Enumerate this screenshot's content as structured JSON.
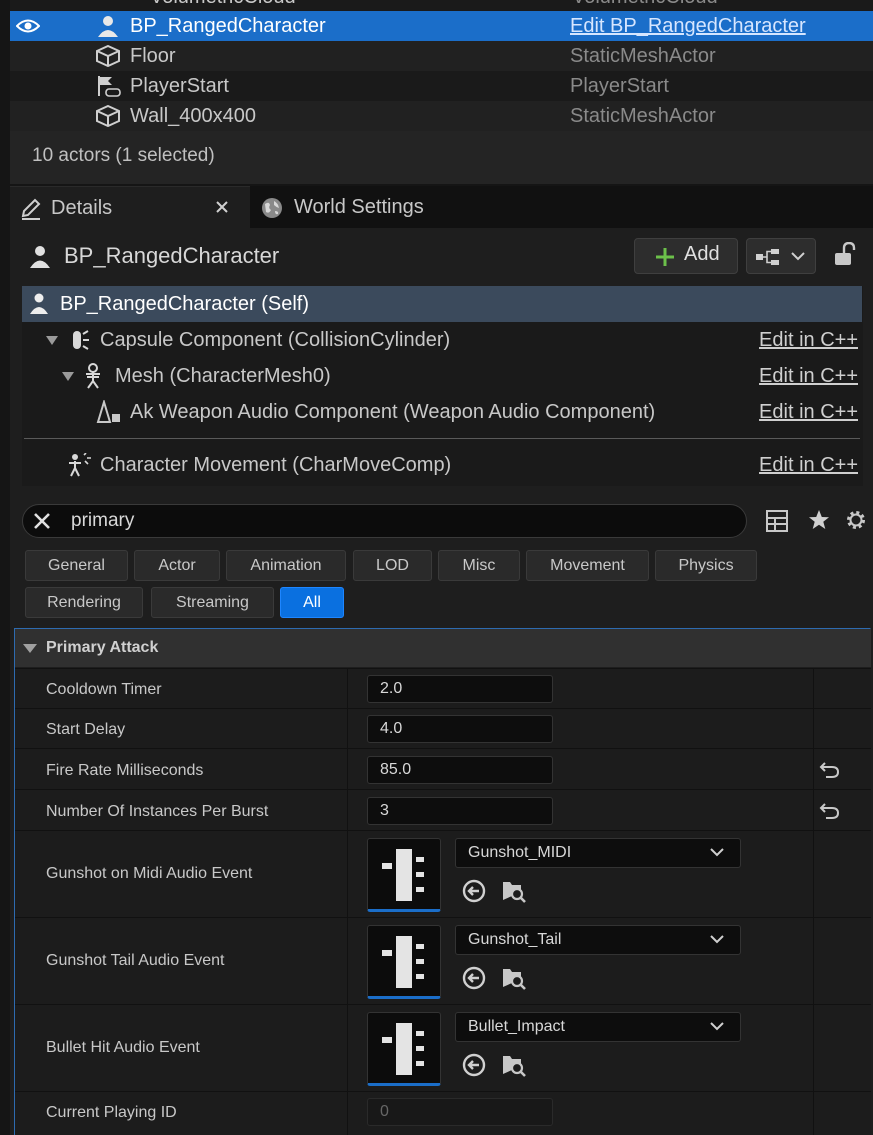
{
  "outliner": {
    "rows": [
      {
        "name": "VolumetricCloud",
        "type": "VolumetricCloud"
      },
      {
        "name": "BP_RangedCharacter",
        "type": "Edit BP_RangedCharacter"
      },
      {
        "name": "Floor",
        "type": "StaticMeshActor"
      },
      {
        "name": "PlayerStart",
        "type": "PlayerStart"
      },
      {
        "name": "Wall_400x400",
        "type": "StaticMeshActor"
      }
    ],
    "actor_count": "10 actors (1 selected)"
  },
  "tabs": {
    "details": "Details",
    "world_settings": "World Settings"
  },
  "details": {
    "actor_name": "BP_RangedCharacter",
    "add_label": "Add",
    "components": [
      {
        "label": "BP_RangedCharacter (Self)",
        "edit": ""
      },
      {
        "label": "Capsule Component (CollisionCylinder)",
        "edit": "Edit in C++"
      },
      {
        "label": "Mesh (CharacterMesh0)",
        "edit": "Edit in C++"
      },
      {
        "label": "Ak Weapon Audio Component (Weapon Audio Component)",
        "edit": "Edit in C++"
      },
      {
        "label": "Character Movement (CharMoveComp)",
        "edit": "Edit in C++"
      }
    ],
    "search_value": "primary",
    "filters": [
      "General",
      "Actor",
      "Animation",
      "LOD",
      "Misc",
      "Movement",
      "Physics",
      "Rendering",
      "Streaming",
      "All"
    ],
    "active_filter": "All",
    "category": "Primary Attack",
    "properties": {
      "cooldown_timer": {
        "label": "Cooldown Timer",
        "value": "2.0"
      },
      "start_delay": {
        "label": "Start Delay",
        "value": "4.0"
      },
      "fire_rate": {
        "label": "Fire Rate Milliseconds",
        "value": "85.0"
      },
      "instances_per_burst": {
        "label": "Number Of Instances Per Burst",
        "value": "3"
      },
      "gunshot_midi": {
        "label": "Gunshot on Midi Audio Event",
        "value": "Gunshot_MIDI"
      },
      "gunshot_tail": {
        "label": "Gunshot Tail Audio Event",
        "value": "Gunshot_Tail"
      },
      "bullet_hit": {
        "label": "Bullet Hit Audio Event",
        "value": "Bullet_Impact"
      },
      "current_playing_id": {
        "label": "Current Playing ID",
        "value": "0"
      }
    }
  },
  "colors": {
    "selection": "#1b6ec9",
    "self_row": "#3b4a5c",
    "active_filter": "#0a70e0",
    "add_plus": "#6cc04a"
  }
}
